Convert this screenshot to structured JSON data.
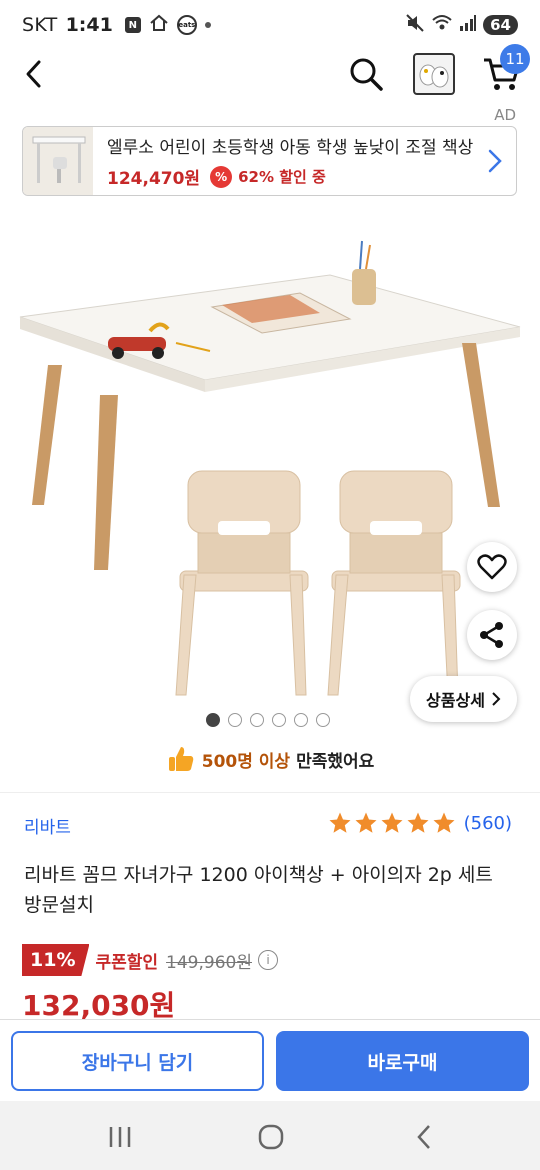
{
  "status_bar": {
    "carrier": "SKT",
    "time": "1:41",
    "icon_n": "N",
    "icon_eats": "eats",
    "battery": "64"
  },
  "header": {
    "cart_badge": "11"
  },
  "ad": {
    "label": "AD",
    "title": "엘루소 어린이 초등학생 아동 학생 높낮이 조절 책상",
    "price": "124,470원",
    "pct_icon": "%",
    "discount": "62% 할인 중"
  },
  "gallery": {
    "detail_button": "상품상세",
    "total_images": 6,
    "active_index": 0
  },
  "satisfaction": {
    "highlight": "500명 이상",
    "rest": "만족했어요"
  },
  "product": {
    "brand": "리바트",
    "rating": 5,
    "review_count": "(560)",
    "title": "리바트 꼼므 자녀가구 1200 아이책상 + 아이의자 2p 세트 방문설치",
    "discount_percent": "11%",
    "coupon_label": "쿠폰할인",
    "original_price": "149,960원",
    "final_price": "132,030원"
  },
  "actions": {
    "add_to_cart": "장바구니 담기",
    "buy_now": "바로구매"
  },
  "colors": {
    "accent_blue": "#3b76e8",
    "sale_red": "#c62828",
    "star_orange": "#f08c2b"
  }
}
